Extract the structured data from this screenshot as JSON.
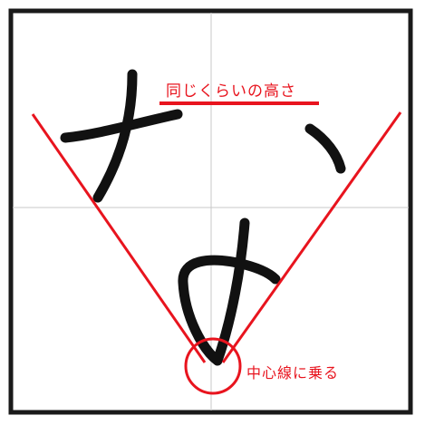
{
  "annotations": {
    "same_height": "同じくらいの高さ",
    "on_center_line": "中心線に乗る"
  },
  "colors": {
    "guide": "#e8141e",
    "ink": "#111111",
    "frame": "#1a1a1a",
    "grid": "#c8c8c8",
    "paper": "#ffffff"
  }
}
